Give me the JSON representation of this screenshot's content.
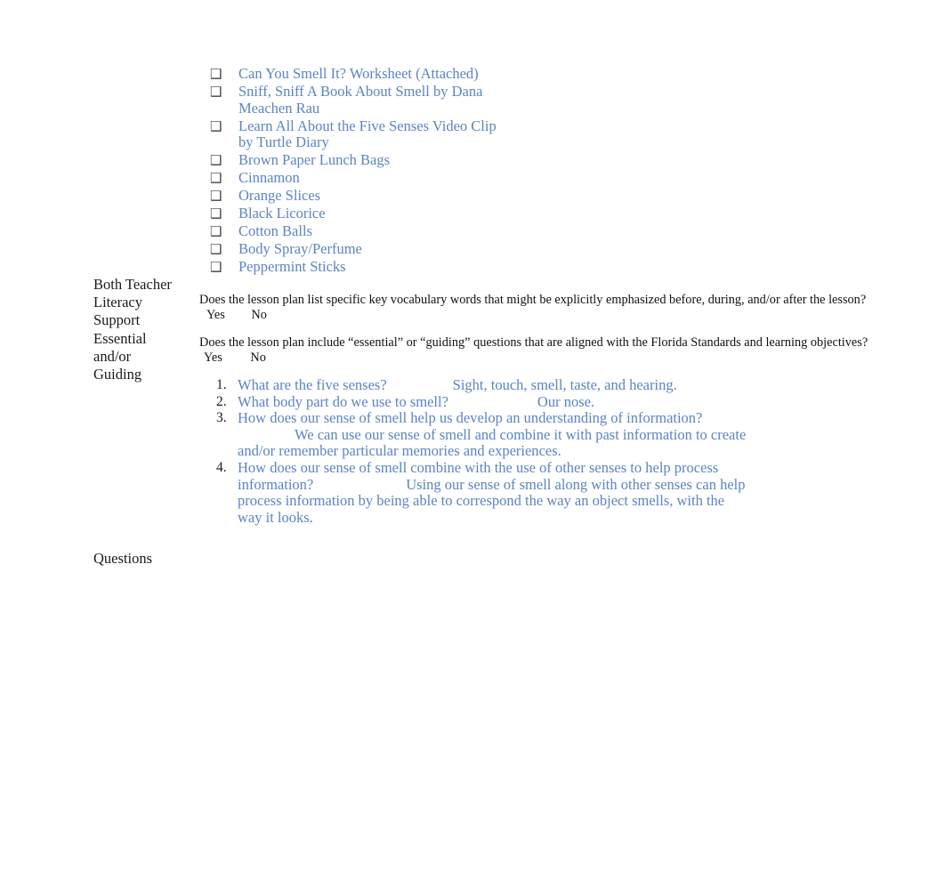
{
  "materials": {
    "bullet_glyph": "❑",
    "items": [
      "Can You Smell It? Worksheet (Attached)",
      "Sniff, Sniff A Book About Smell by Dana Meachen Rau",
      "Learn All About the Five Senses Video Clip by Turtle Diary",
      "Brown Paper Lunch Bags",
      "Cinnamon",
      "Orange Slices",
      "Black Licorice",
      "Cotton Balls",
      "Body Spray/Perfume",
      "Peppermint Sticks"
    ]
  },
  "sidebar": {
    "literacy_support": {
      "line1": "Both Teacher",
      "line2": "Literacy",
      "line3": "Support",
      "line4": "Essential",
      "line5": "and/or",
      "line6": "Guiding"
    },
    "questions_label": "Questions"
  },
  "checklist": {
    "question_1": {
      "text": "Does the lesson plan list specific key vocabulary words that might be explicitly emphasized before, during, and/or after the lesson?",
      "option_yes": "Yes",
      "option_no": "No"
    },
    "question_2": {
      "text": "Does the lesson plan include “essential” or “guiding” questions that are aligned with the Florida Standards and learning objectives?",
      "option_yes": "Yes",
      "option_no": "No"
    }
  },
  "qa_list": [
    {
      "number": "1.",
      "question": "What are the five senses?",
      "answer": "Sight, touch, smell, taste, and hearing."
    },
    {
      "number": "2.",
      "question": "What body part do we use to smell?",
      "answer": "Our nose."
    },
    {
      "number": "3.",
      "question": "How does our sense of smell help us develop an understanding of information?",
      "answer": "We can use our sense of smell and combine it with past information to create and/or remember particular memories and experiences."
    },
    {
      "number": "4.",
      "question": "How does our sense of smell combine with the use of other senses to help process information?",
      "answer": "Using our sense of smell along with other senses can help process information by being able to correspond the way an object smells, with the way it looks."
    }
  ],
  "colors": {
    "link_blue": "#5b84c4",
    "body_black": "#111111",
    "bullet_gray": "#404040"
  }
}
